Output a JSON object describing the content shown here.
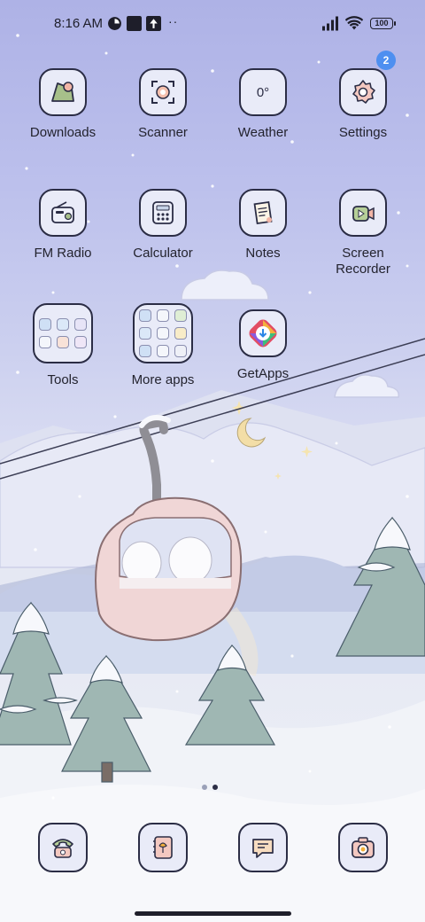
{
  "status_bar": {
    "time": "8:16 AM",
    "battery": "100",
    "icons": [
      "data-saver-icon",
      "notification-square-icon",
      "upload-icon",
      "more-dots-icon",
      "signal-icon",
      "wifi-icon",
      "battery-icon"
    ]
  },
  "apps": [
    {
      "label": "Downloads",
      "icon": "downloads-icon"
    },
    {
      "label": "Scanner",
      "icon": "scanner-icon"
    },
    {
      "label": "Weather",
      "icon": "weather-icon",
      "tile_text": "0°"
    },
    {
      "label": "Settings",
      "icon": "gear-icon",
      "badge": "2"
    },
    {
      "label": "FM Radio",
      "icon": "radio-icon"
    },
    {
      "label": "Calculator",
      "icon": "calculator-icon"
    },
    {
      "label": "Notes",
      "icon": "notes-icon"
    },
    {
      "label": "Screen Recorder",
      "label_line1": "Screen",
      "label_line2": "Recorder",
      "icon": "screen-recorder-icon"
    },
    {
      "label": "Tools",
      "icon": "folder-icon"
    },
    {
      "label": "More apps",
      "icon": "folder-icon"
    },
    {
      "label": "GetApps",
      "icon": "getapps-icon"
    }
  ],
  "dock": [
    {
      "name": "phone",
      "icon": "phone-icon"
    },
    {
      "name": "contacts",
      "icon": "contacts-icon"
    },
    {
      "name": "messages",
      "icon": "messages-icon"
    },
    {
      "name": "camera",
      "icon": "camera-icon"
    }
  ],
  "page_indicator": {
    "pages": 2,
    "current": 2
  },
  "colors": {
    "badge": "#4e8ff0",
    "icon_outline": "#2b2d45",
    "tile_bg": "#e9ebf8"
  }
}
